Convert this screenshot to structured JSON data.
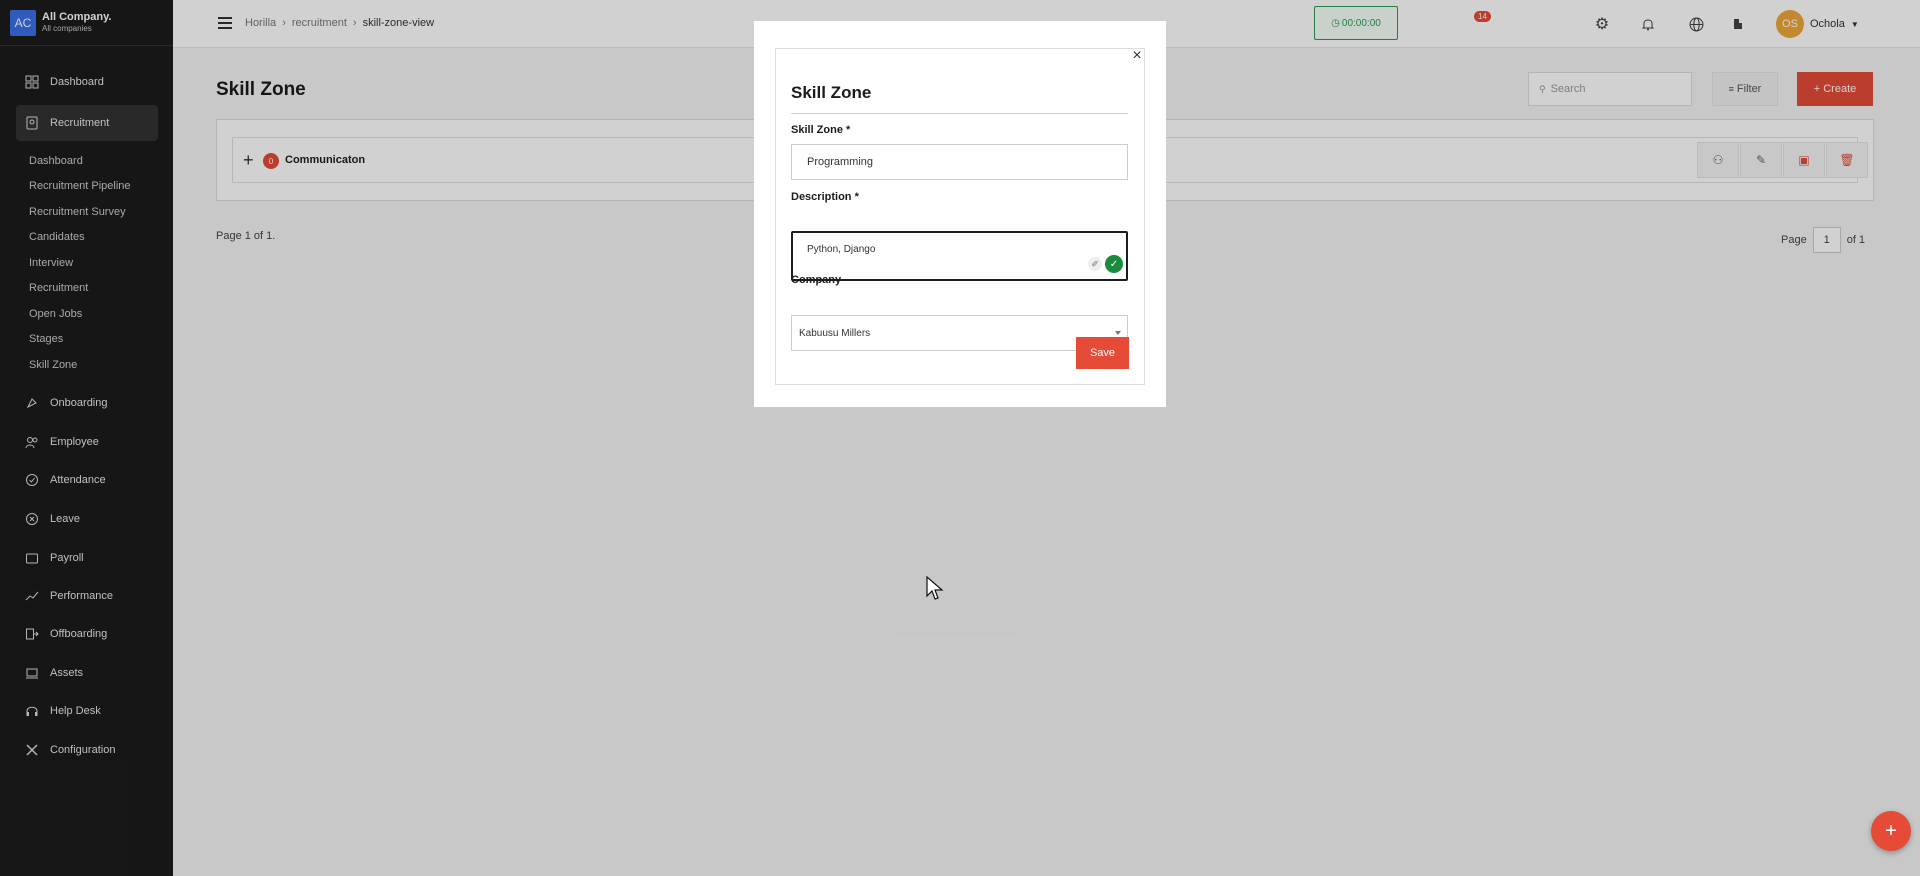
{
  "company": {
    "logo": "AC",
    "name": "All Company.",
    "sub": "All companies"
  },
  "sidebar": {
    "items": [
      {
        "label": "Dashboard",
        "icon": "grid-icon"
      },
      {
        "label": "Recruitment",
        "icon": "recruitment-icon"
      },
      {
        "label": "Onboarding",
        "icon": "rocket-icon"
      },
      {
        "label": "Employee",
        "icon": "people-icon"
      },
      {
        "label": "Attendance",
        "icon": "check-circle-icon"
      },
      {
        "label": "Leave",
        "icon": "x-circle-icon"
      },
      {
        "label": "Payroll",
        "icon": "wallet-icon"
      },
      {
        "label": "Performance",
        "icon": "trend-icon"
      },
      {
        "label": "Offboarding",
        "icon": "exit-icon"
      },
      {
        "label": "Assets",
        "icon": "laptop-icon"
      },
      {
        "label": "Help Desk",
        "icon": "headset-icon"
      },
      {
        "label": "Configuration",
        "icon": "tools-icon"
      }
    ],
    "sub_items": [
      "Dashboard",
      "Recruitment Pipeline",
      "Recruitment Survey",
      "Candidates",
      "Interview",
      "Recruitment",
      "Open Jobs",
      "Stages",
      "Skill Zone"
    ]
  },
  "header": {
    "breadcrumb": [
      "Horilla",
      "recruitment",
      "skill-zone-view"
    ],
    "timer": "00:00:00",
    "notification_count": "14",
    "user_initials": "OS",
    "user_name": "Ochola"
  },
  "main": {
    "title": "Skill Zone",
    "search_placeholder": "Search",
    "filter_label": "Filter",
    "create_label": "+ Create",
    "zone": {
      "count": "0",
      "name": "Communicaton"
    },
    "page_info": "Page 1 of 1.",
    "pager": {
      "label": "Page",
      "current": "1",
      "of": "of 1"
    }
  },
  "modal": {
    "title": "Skill Zone",
    "skill_zone_label": "Skill Zone",
    "skill_zone_value": "Programming",
    "description_label": "Description",
    "description_value": "Python, Django",
    "company_label": "Company",
    "company_value": "Kabuusu Millers",
    "required_mark": "*",
    "save_label": "Save",
    "close_glyph": "×"
  },
  "colors": {
    "accent": "#e54b37",
    "sidebar": "#1c1c1c",
    "timer": "#2e9a4e"
  }
}
